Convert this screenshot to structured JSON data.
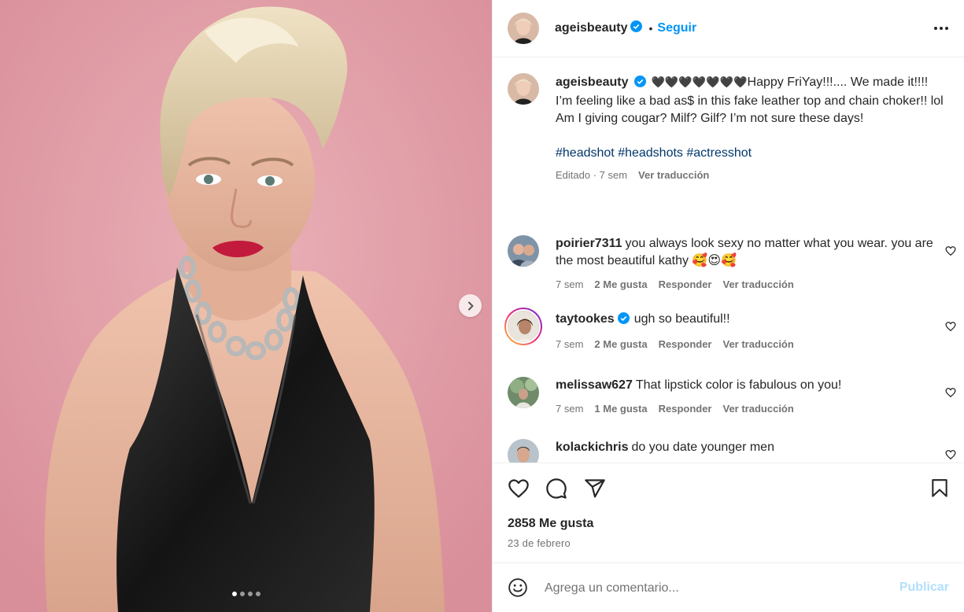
{
  "media": {
    "slide_count": 4,
    "active_slide": 1
  },
  "header": {
    "username": "ageisbeauty",
    "separator": "•",
    "follow_label": "Seguir"
  },
  "caption": {
    "username": "ageisbeauty",
    "hearts": "🖤🖤🖤🖤🖤🖤🖤",
    "line1": "Happy FriYay!!!.... We made it!!!!",
    "line2": "I’m feeling like a bad as$ in this fake leather top and chain choker!! lol Am I giving cougar? Milf? Gilf? I’m not sure these days!",
    "hashtags": [
      "#headshot",
      "#headshots",
      "#actresshot"
    ],
    "edited": "Editado · 7 sem",
    "translate": "Ver traducción"
  },
  "comments": [
    {
      "username": "poirier7311",
      "text": "you always look sexy no matter what you wear. you are the most beautiful kathy 🥰😍🥰",
      "time": "7 sem",
      "likes": "2 Me gusta",
      "reply": "Responder",
      "translate": "Ver traducción"
    },
    {
      "username": "taytookes",
      "text": "ugh so beautiful!!",
      "time": "7 sem",
      "likes": "2 Me gusta",
      "reply": "Responder",
      "translate": "Ver traducción"
    },
    {
      "username": "melissaw627",
      "text": "That lipstick color is fabulous on you!",
      "time": "7 sem",
      "likes": "1 Me gusta",
      "reply": "Responder",
      "translate": "Ver traducción"
    },
    {
      "username": "kolackichris",
      "text": "do you date younger men"
    }
  ],
  "footer": {
    "likes": "2858 Me gusta",
    "date": "23 de febrero",
    "comment_placeholder": "Agrega un comentario...",
    "publish_label": "Publicar"
  },
  "colors": {
    "link": "#0095f6",
    "hashtag": "#00376b",
    "publish_disabled": "#b2dffc",
    "media_bg": "#e2a0aa"
  }
}
